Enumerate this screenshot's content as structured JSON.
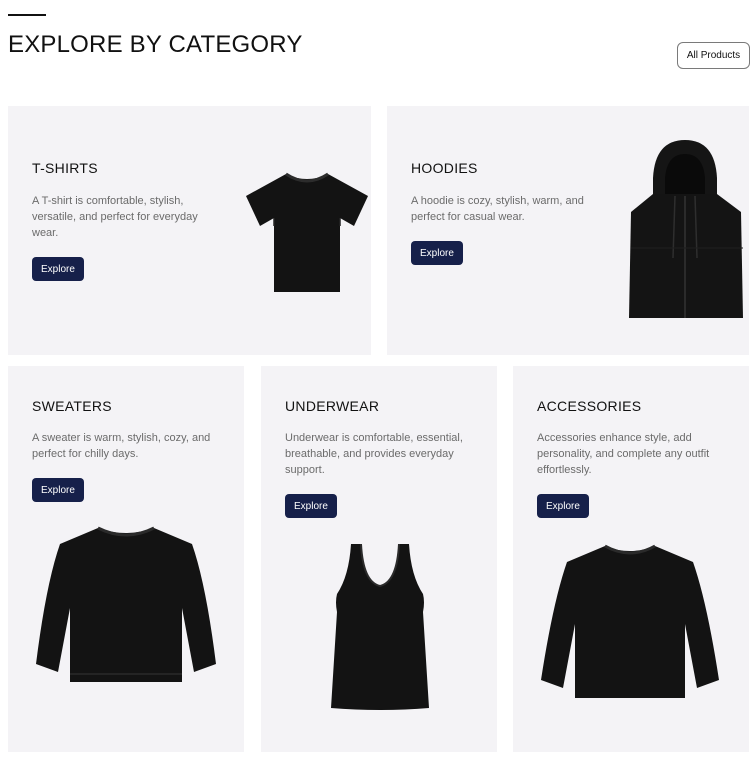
{
  "header": {
    "title": "EXPLORE BY CATEGORY",
    "all_products_label": "All Products"
  },
  "categories": [
    {
      "title": "T-SHIRTS",
      "description": "A T-shirt is comfortable, stylish, versatile, and perfect for everyday wear.",
      "button_label": "Explore",
      "image": "black-tshirt"
    },
    {
      "title": "HOODIES",
      "description": "A hoodie is cozy, stylish, warm, and perfect for casual wear.",
      "button_label": "Explore",
      "image": "black-hoodie"
    },
    {
      "title": "SWEATERS",
      "description": "A sweater is warm, stylish, cozy, and perfect for chilly days.",
      "button_label": "Explore",
      "image": "black-sweater"
    },
    {
      "title": "UNDERWEAR",
      "description": "Underwear is comfortable, essential, breathable, and provides everyday support.",
      "button_label": "Explore",
      "image": "black-tank-top"
    },
    {
      "title": "ACCESSORIES",
      "description": "Accessories enhance style, add personality, and complete any outfit effortlessly.",
      "button_label": "Explore",
      "image": "black-long-sleeve"
    }
  ],
  "colors": {
    "card_background": "#f4f3f6",
    "button_background": "#16204a",
    "button_text": "#ffffff",
    "description_text": "#6b6b6b"
  }
}
